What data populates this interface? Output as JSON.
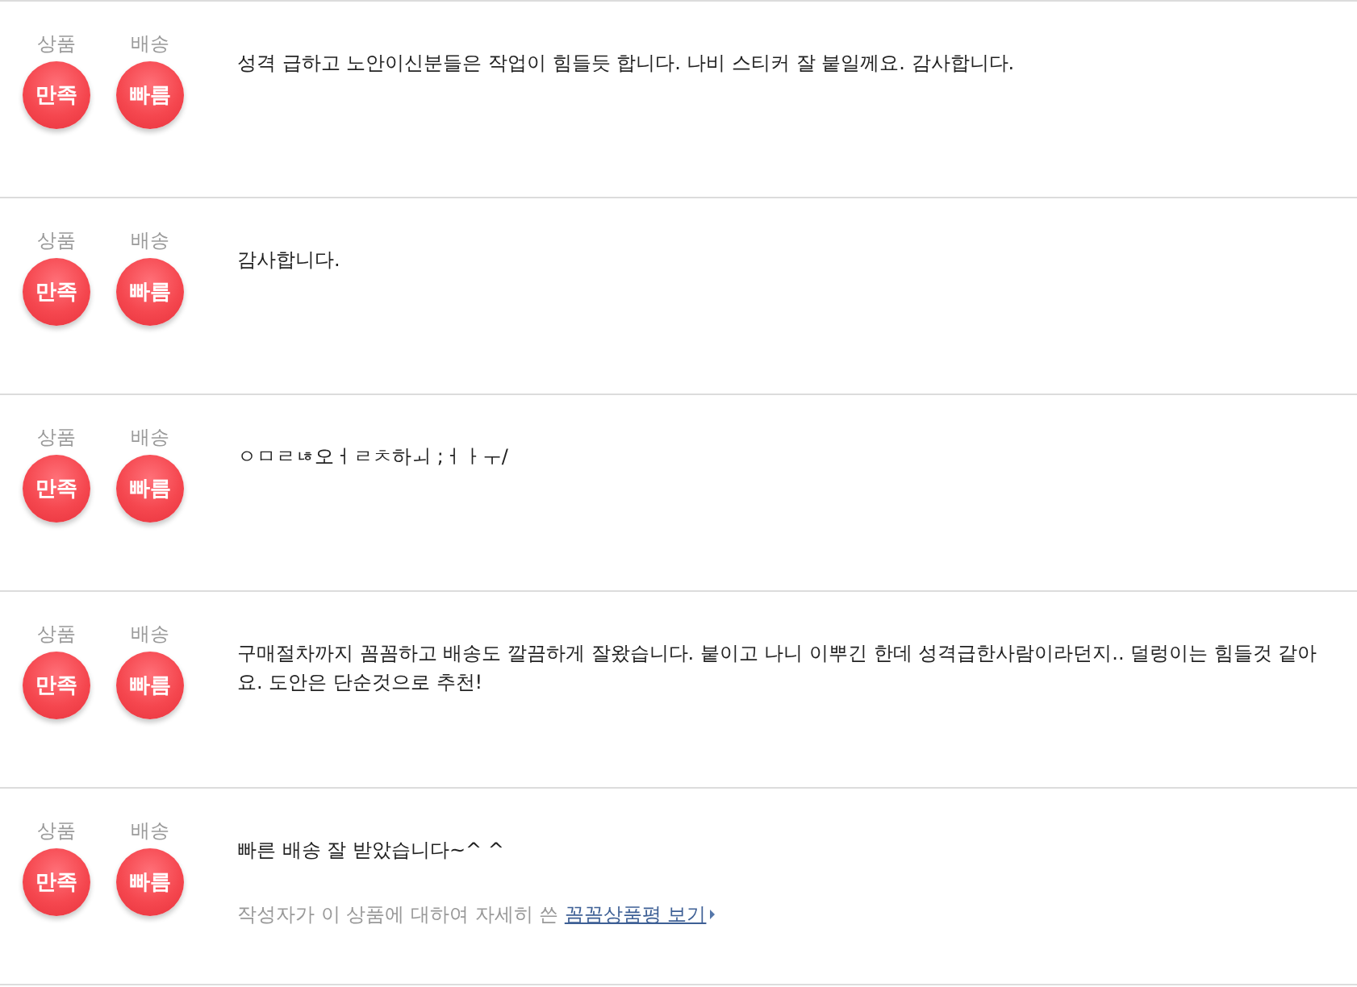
{
  "reviews": [
    {
      "ratings": [
        {
          "label": "상품",
          "value": "만족"
        },
        {
          "label": "배송",
          "value": "빠름"
        }
      ],
      "text": "성격 급하고 노안이신분들은 작업이 힘들듯 합니다. 나비 스티커 잘 붙일께요. 감사합니다."
    },
    {
      "ratings": [
        {
          "label": "상품",
          "value": "만족"
        },
        {
          "label": "배송",
          "value": "빠름"
        }
      ],
      "text": "감사합니다."
    },
    {
      "ratings": [
        {
          "label": "상품",
          "value": "만족"
        },
        {
          "label": "배송",
          "value": "빠름"
        }
      ],
      "text": "ㅇㅁㄹㄶ오ㅓㄹㅊ하ㅚ ;ㅓㅏㅜ/"
    },
    {
      "ratings": [
        {
          "label": "상품",
          "value": "만족"
        },
        {
          "label": "배송",
          "value": "빠름"
        }
      ],
      "text": "구매절차까지 꼼꼼하고 배송도 깔끔하게 잘왔습니다. 붙이고 나니 이뿌긴 한데 성격급한사람이라던지.. 덜렁이는 힘들것 같아요. 도안은 단순것으로 추천!"
    },
    {
      "ratings": [
        {
          "label": "상품",
          "value": "만족"
        },
        {
          "label": "배송",
          "value": "빠름"
        }
      ],
      "text": "빠른 배송 잘 받았습니다~^ ^",
      "note": {
        "text": "작성자가 이 상품에 대하여 자세히 쓴",
        "link": "꼼꼼상품평 보기"
      }
    }
  ]
}
